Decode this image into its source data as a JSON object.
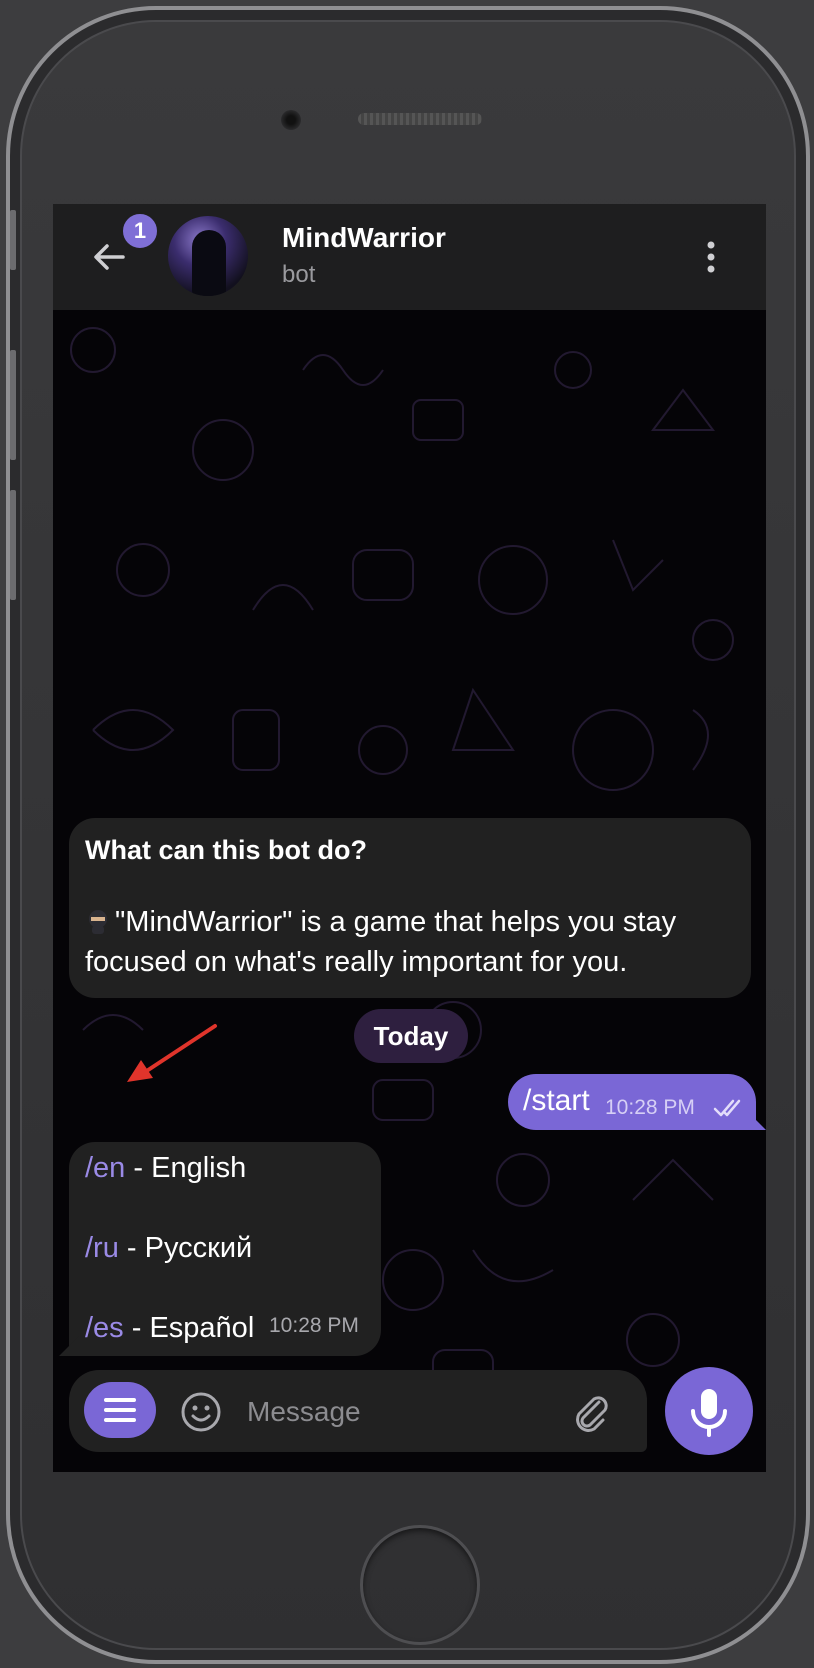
{
  "header": {
    "title": "MindWarrior",
    "subtitle": "bot",
    "unread_badge": "1"
  },
  "messages": {
    "intro_title": "What can this bot do?",
    "intro_text": "\"MindWarrior\" is a game that helps you stay focused on what's really important for you.",
    "date_chip": "Today",
    "outgoing_text": "/start",
    "outgoing_time": "10:28 PM",
    "commands": [
      {
        "command": "/en",
        "label": " - English"
      },
      {
        "command": "/ru",
        "label": " - Русский"
      },
      {
        "command": "/es",
        "label": " - Español"
      }
    ],
    "commands_time": "10:28 PM"
  },
  "input": {
    "placeholder": "Message"
  },
  "colors": {
    "accent": "#7a67d6",
    "link": "#9a8ae6",
    "bubble_in": "#212121",
    "header_bg": "#1e1e1f",
    "annotation_arrow": "#e0342b"
  },
  "icons": {
    "back": "arrow-left-icon",
    "more": "more-vertical-icon",
    "menu": "menu-icon",
    "emoji": "smiley-icon",
    "attach": "paperclip-icon",
    "mic": "microphone-icon",
    "read": "double-check-icon"
  }
}
